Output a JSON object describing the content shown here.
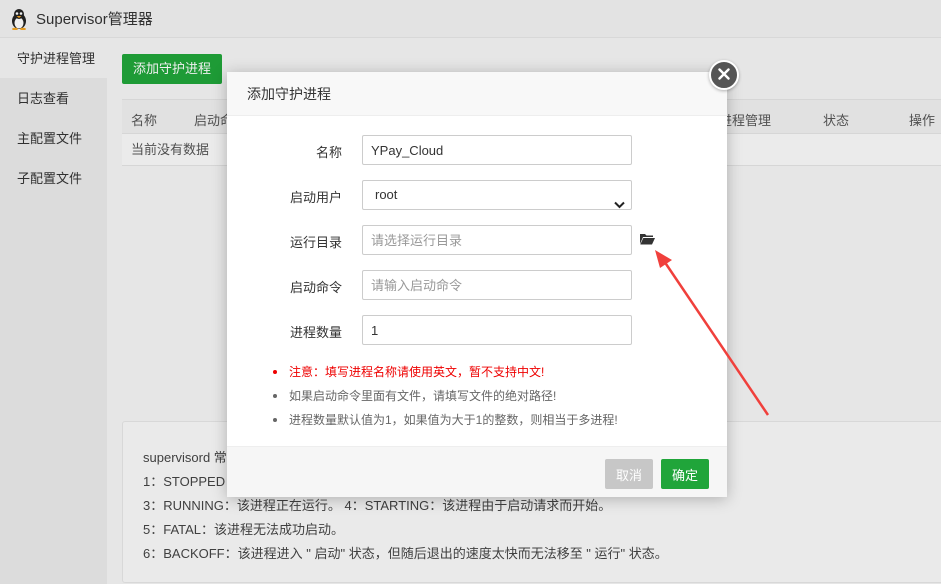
{
  "app": {
    "title": "Supervisor管理器",
    "logo_icon": "tux-penguin-icon"
  },
  "sidebar": {
    "items": [
      {
        "label": "守护进程管理",
        "active": true
      },
      {
        "label": "日志查看",
        "active": false
      },
      {
        "label": "主配置文件",
        "active": false
      },
      {
        "label": "子配置文件",
        "active": false
      }
    ]
  },
  "main": {
    "add_button": "添加守护进程",
    "table": {
      "columns": [
        "名称",
        "启动命",
        "进程管理",
        "状态",
        "操作"
      ],
      "empty_text": "当前没有数据"
    },
    "help": {
      "lines": [
        "supervisord 常",
        "1：STOPPED：",
        "3：RUNNING：该进程正在运行。 4：STARTING：该进程由于启动请求而开始。",
        "5：FATAL：该进程无法成功启动。",
        "6：BACKOFF：该进程进入 \" 启动\" 状态，但随后退出的速度太快而无法移至 \" 运行\" 状态。"
      ]
    }
  },
  "dialog": {
    "title": "添加守护进程",
    "fields": {
      "name": {
        "label": "名称",
        "value": "YPay_Cloud"
      },
      "user": {
        "label": "启动用户",
        "value": "root"
      },
      "dir": {
        "label": "运行目录",
        "placeholder": "请选择运行目录"
      },
      "cmd": {
        "label": "启动命令",
        "placeholder": "请输入启动命令"
      },
      "count": {
        "label": "进程数量",
        "value": "1"
      }
    },
    "notes": [
      "注意：填写进程名称请使用英文，暂不支持中文!",
      "如果启动命令里面有文件，请填写文件的绝对路径!",
      "进程数量默认值为1，如果值为大于1的整数，则相当于多进程!"
    ],
    "cancel_label": "取消",
    "ok_label": "确定"
  },
  "colors": {
    "accent": "#20a53a",
    "warning": "#ee0000",
    "arrow": "#f0403c"
  }
}
